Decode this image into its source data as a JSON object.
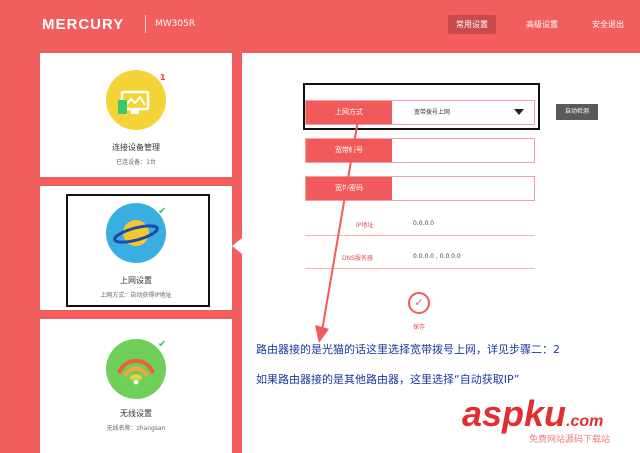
{
  "header": {
    "brand": "MERCURY",
    "model": "MW305R",
    "nav": [
      "常用设置",
      "高级设置",
      "安全退出"
    ]
  },
  "sidebar": {
    "cards": [
      {
        "title": "连接设备管理",
        "subtitle": "已连设备：1台",
        "badge": "1"
      },
      {
        "title": "上网设置",
        "subtitle": "上网方式：自动获得IP地址"
      },
      {
        "title": "无线设置",
        "subtitle": "无线名称：zhangsan"
      }
    ]
  },
  "form": {
    "connection_type_label": "上网方式",
    "connection_type_value": "宽带拨号上网",
    "auto_detect_button": "自动检测",
    "account_label": "宽带帐号",
    "account_value": "",
    "password_label": "宽带密码",
    "password_value": "",
    "ip_label": "IP地址",
    "ip_value": "0.0.0.0",
    "dns_label": "DNS服务器",
    "dns_value": "0.0.0.0 , 0.0.0.0",
    "save_label": "保存"
  },
  "annotation": {
    "line1": "路由器接的是光猫的话这里选择宽带拨号上网，详见步骤二：2",
    "line2": "如果路由器接的是其他路由器，这里选择“自动获取IP”"
  },
  "watermark": {
    "text": "aspku",
    "suffix": ".com",
    "sub": "免费网站源码下载站"
  },
  "colors": {
    "background": "#f25d5d",
    "accent": "#f05a5a",
    "check": "#3cc86a",
    "annotation": "#1a3a9c"
  }
}
